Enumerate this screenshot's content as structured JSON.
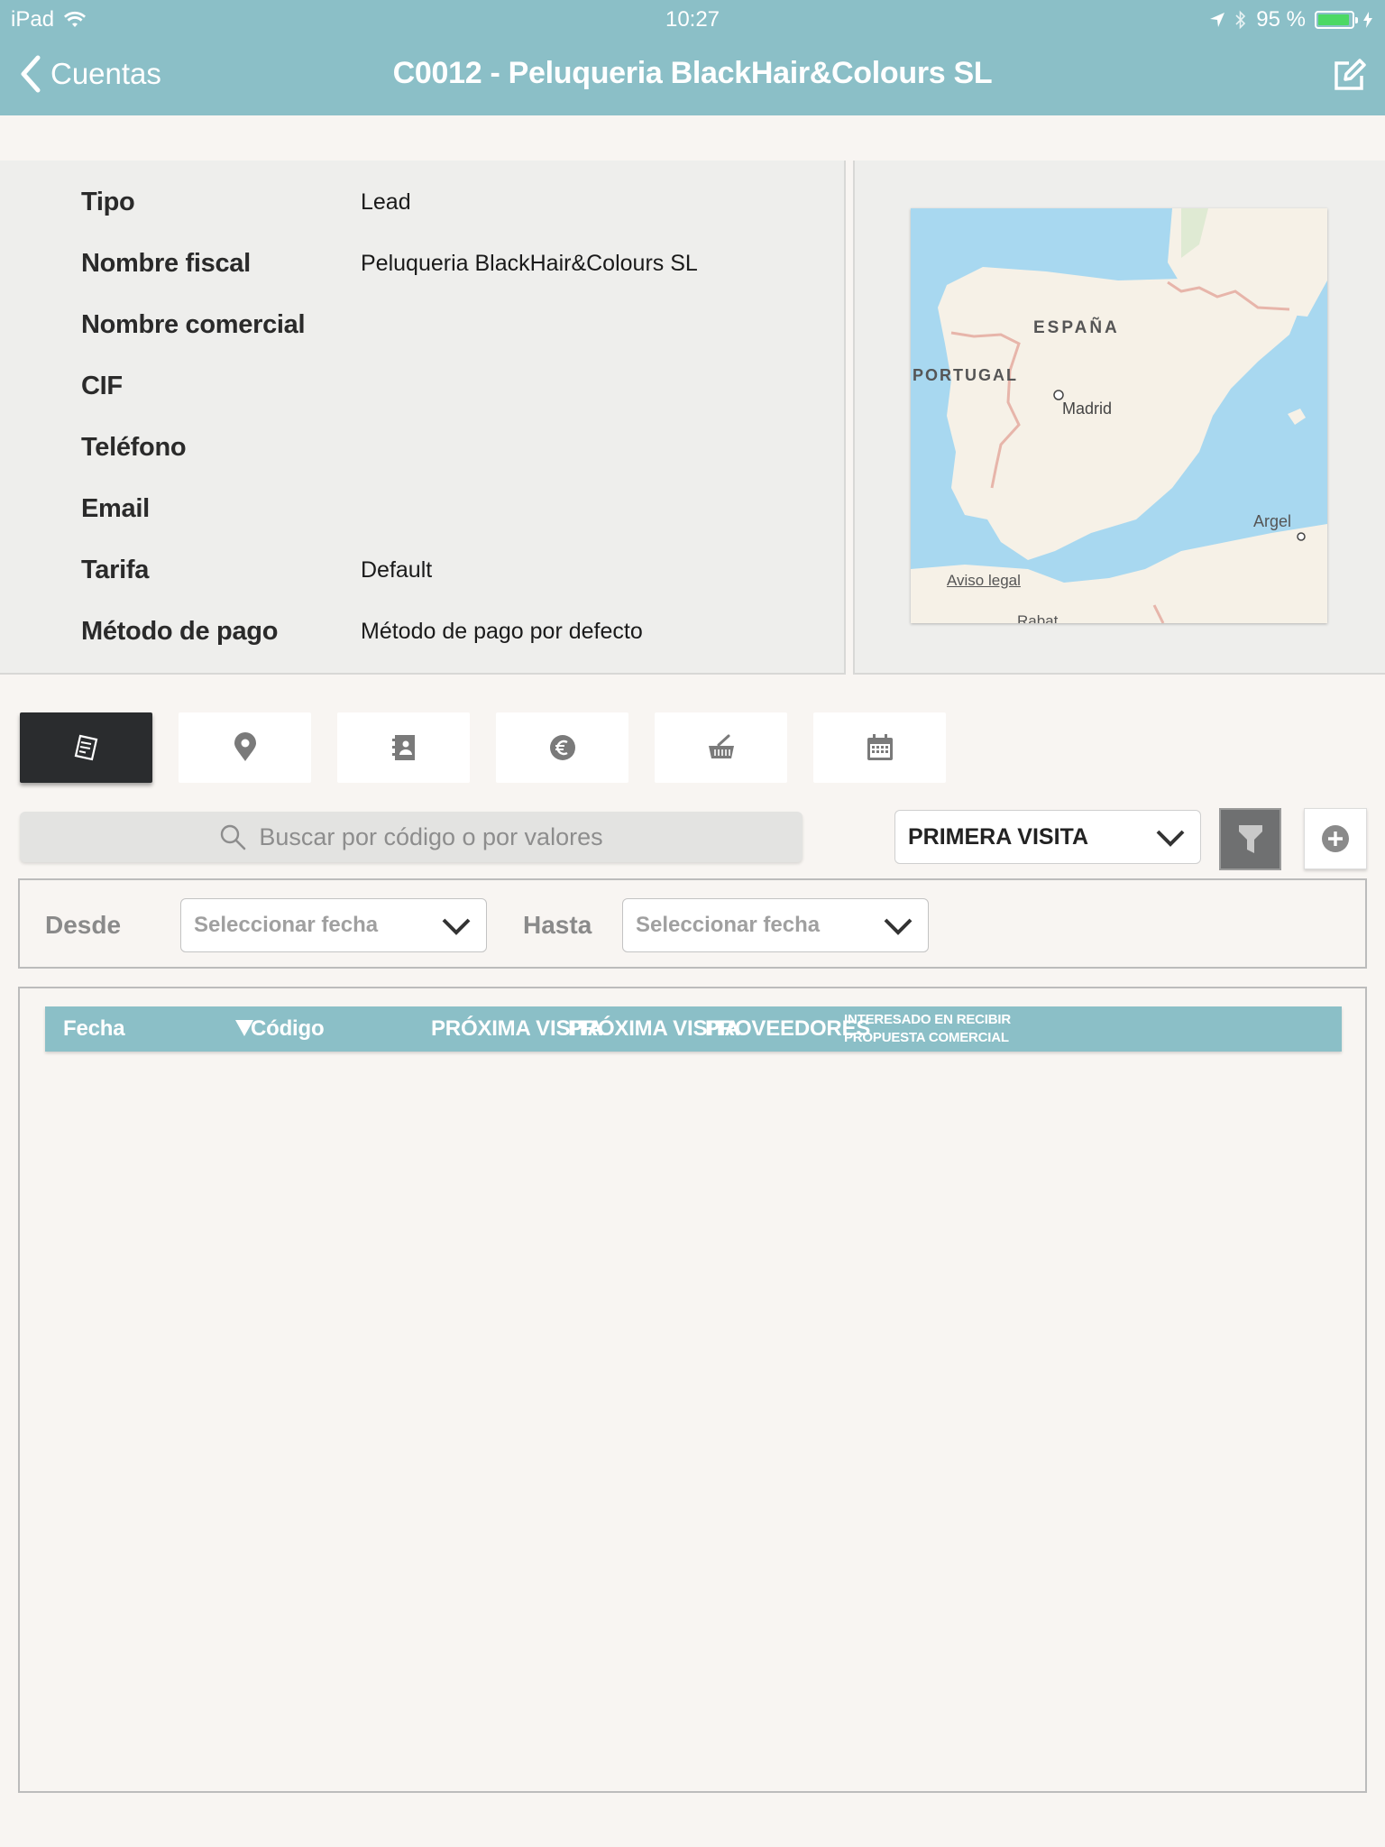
{
  "status_bar": {
    "device": "iPad",
    "time": "10:27",
    "battery": "95 %",
    "battery_level_pct": 95
  },
  "nav": {
    "back_label": "Cuentas",
    "title": "C0012 - Peluqueria BlackHair&Colours SL",
    "edit_icon": "edit-icon"
  },
  "info": {
    "rows": [
      {
        "label": "Tipo",
        "value": "Lead"
      },
      {
        "label": "Nombre fiscal",
        "value": "Peluqueria BlackHair&Colours SL"
      },
      {
        "label": "Nombre comercial",
        "value": ""
      },
      {
        "label": "CIF",
        "value": ""
      },
      {
        "label": "Teléfono",
        "value": ""
      },
      {
        "label": "Email",
        "value": ""
      },
      {
        "label": "Tarifa",
        "value": "Default"
      },
      {
        "label": "Método de pago",
        "value": "Método de pago por defecto"
      }
    ]
  },
  "map": {
    "country_label": "ESPAÑA",
    "neighbor_label": "PORTUGAL",
    "city_label": "Madrid",
    "city2_label": "Argel",
    "city3_label": "Rabat",
    "legal_label": "Aviso legal"
  },
  "tabs": [
    {
      "icon": "document-icon",
      "active": true
    },
    {
      "icon": "location-pin-icon",
      "active": false
    },
    {
      "icon": "contacts-book-icon",
      "active": false
    },
    {
      "icon": "euro-icon",
      "active": false
    },
    {
      "icon": "basket-icon",
      "active": false
    },
    {
      "icon": "calendar-icon",
      "active": false
    }
  ],
  "search": {
    "placeholder": "Buscar por código o por valores"
  },
  "type_select": {
    "value": "PRIMERA VISITA"
  },
  "date_filter": {
    "from_label": "Desde",
    "from_placeholder": "Seleccionar fecha",
    "to_label": "Hasta",
    "to_placeholder": "Seleccionar fecha"
  },
  "table": {
    "headers": [
      "Fecha",
      "Código",
      "PRÓXIMA VISITA",
      "PRÓXIMA VISITA",
      "PROVEEDORES",
      "INTERESADO EN RECIBIR PROPUESTA COMERCIAL"
    ],
    "header_last_line1": "INTERESADO EN RECIBIR",
    "header_last_line2": "PROPUESTA COMERCIAL",
    "rows": []
  },
  "colors": {
    "accent": "#8bbfc7",
    "active_tab": "#2a2c2e",
    "background": "#f8f5f2"
  }
}
